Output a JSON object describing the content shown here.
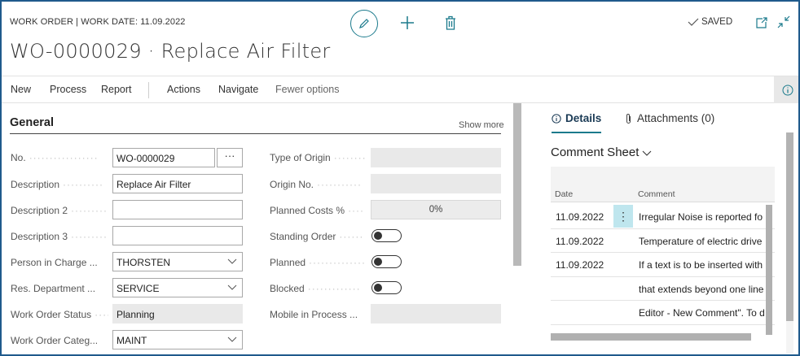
{
  "header": {
    "caption": "WORK ORDER | WORK DATE: 11.09.2022",
    "title": "WO-0000029 · Replace Air Filter",
    "saved_label": "SAVED",
    "icons": [
      "edit-icon",
      "plus-icon",
      "trash-icon",
      "check-icon",
      "open-new-window-icon",
      "collapse-icon"
    ]
  },
  "actions": {
    "new": "New",
    "process": "Process",
    "report": "Report",
    "actions": "Actions",
    "navigate": "Navigate",
    "fewer": "Fewer options"
  },
  "general": {
    "title": "General",
    "show_more": "Show more",
    "left": [
      {
        "label": "No.",
        "value": "WO-0000029"
      },
      {
        "label": "Description",
        "value": "Replace Air Filter"
      },
      {
        "label": "Description 2",
        "value": ""
      },
      {
        "label": "Description 3",
        "value": ""
      },
      {
        "label": "Person in Charge ...",
        "value": "THORSTEN"
      },
      {
        "label": "Res. Department ...",
        "value": "SERVICE"
      },
      {
        "label": "Work Order Status",
        "value": "Planning"
      },
      {
        "label": "Work Order Categ...",
        "value": "MAINT"
      }
    ],
    "ellipsis": "···",
    "right": [
      {
        "label": "Type of Origin",
        "value": ""
      },
      {
        "label": "Origin No.",
        "value": ""
      },
      {
        "label": "Planned Costs %",
        "value": "0%"
      },
      {
        "label": "Standing Order",
        "value": "off"
      },
      {
        "label": "Planned",
        "value": "off"
      },
      {
        "label": "Blocked",
        "value": "off"
      },
      {
        "label": "Mobile in Process ...",
        "value": ""
      }
    ]
  },
  "factbox": {
    "tab_details": "Details",
    "tab_attachments": "Attachments (0)",
    "comment_title": "Comment Sheet",
    "col_date": "Date",
    "col_comment": "Comment",
    "rows": [
      {
        "date": "11.09.2022",
        "comment": "Irregular Noise is reported fo"
      },
      {
        "date": "11.09.2022",
        "comment": "Temperature of electric drive"
      },
      {
        "date": "11.09.2022",
        "comment": "If a text is to be inserted with"
      },
      {
        "date": "",
        "comment": "that extends beyond one line"
      },
      {
        "date": "",
        "comment": "Editor - New Comment\". To d"
      }
    ],
    "row_menu": "⋮"
  }
}
